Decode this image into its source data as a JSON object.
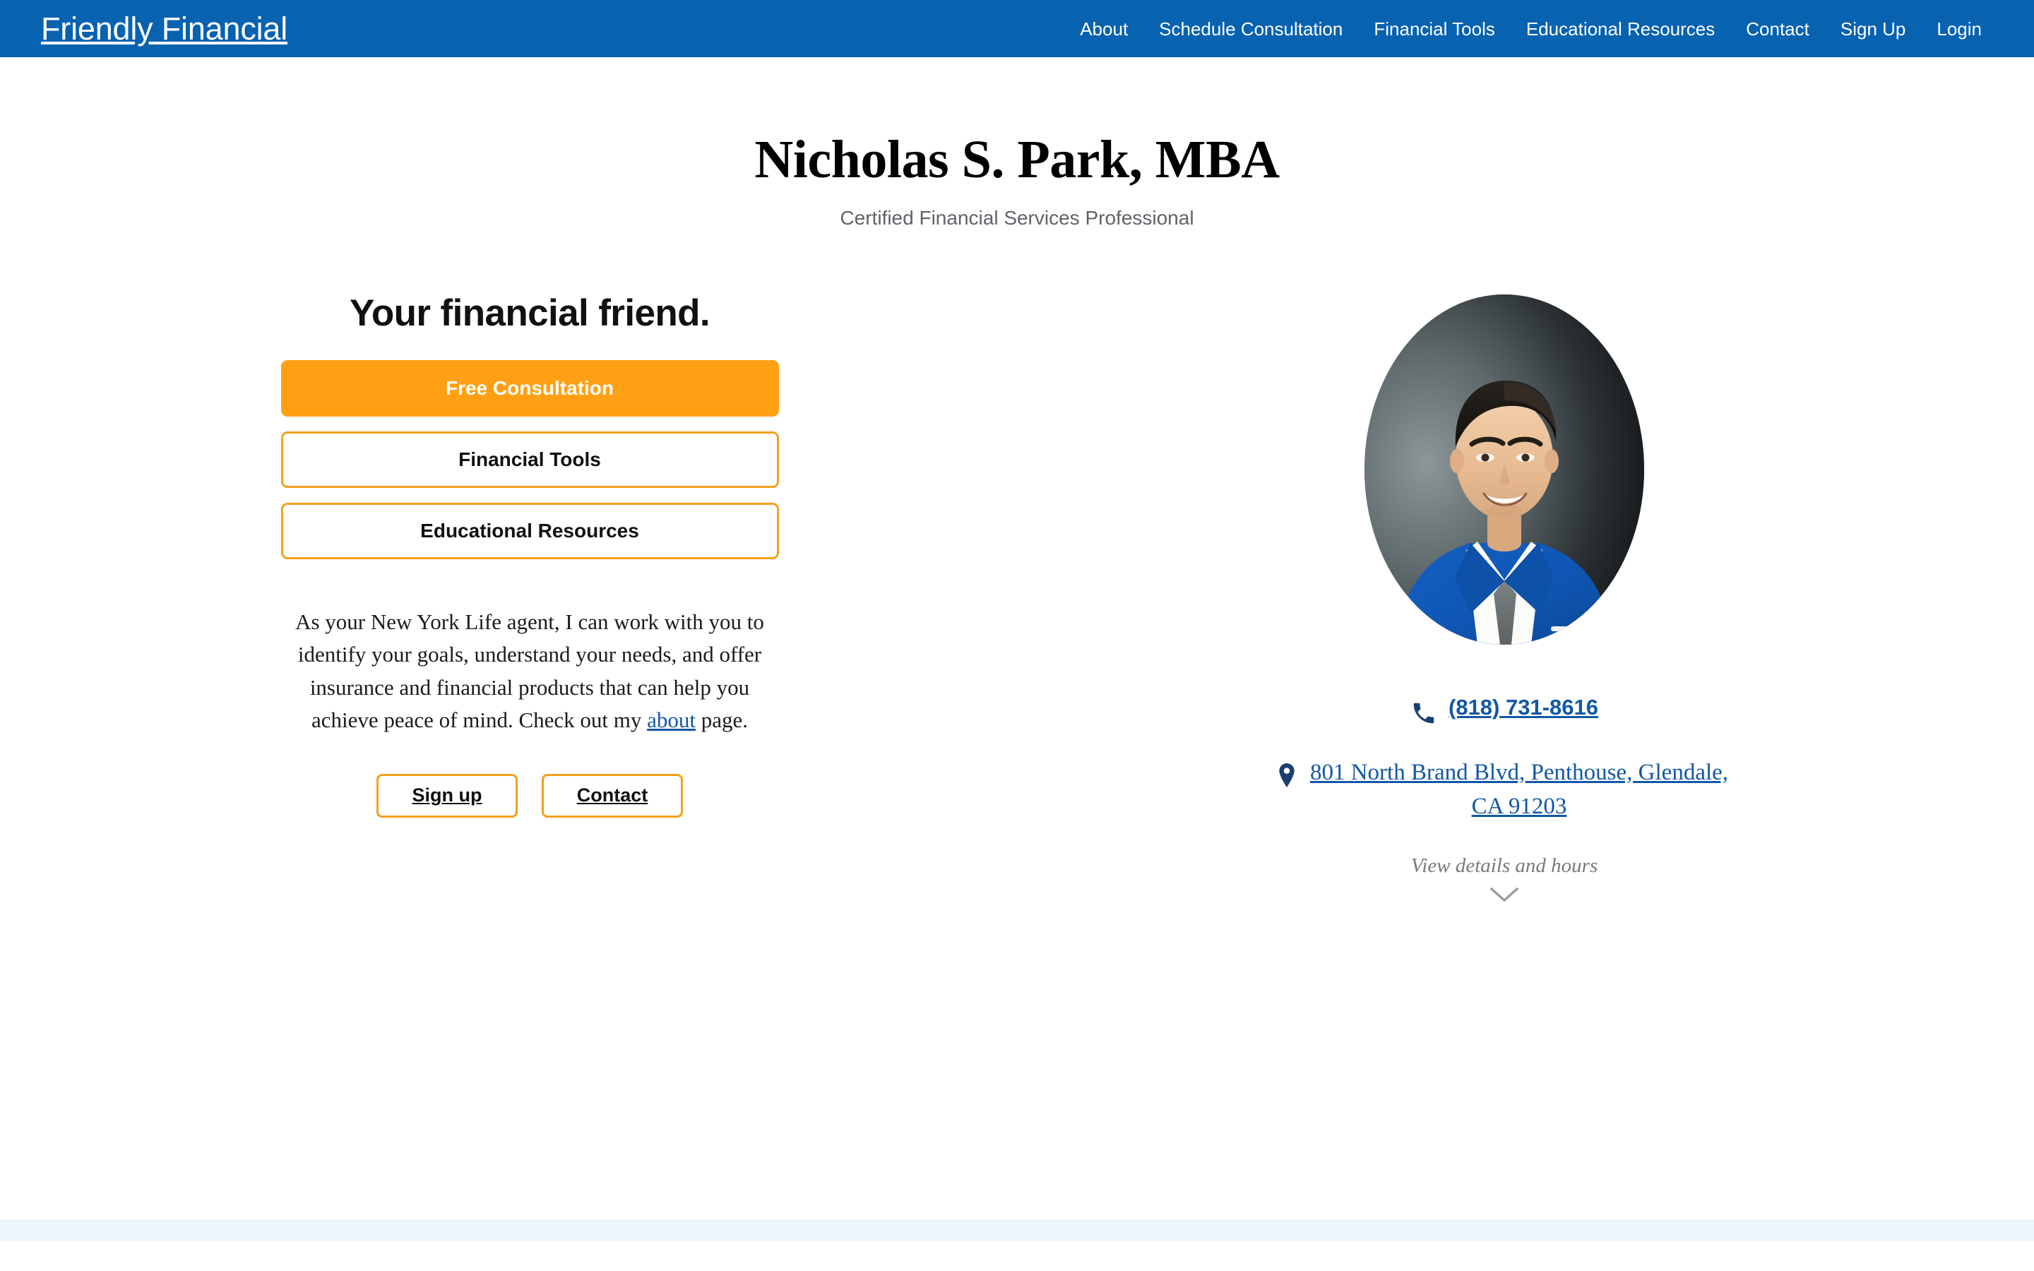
{
  "navbar": {
    "brand": "Friendly Financial",
    "links": [
      {
        "label": "About"
      },
      {
        "label": "Schedule Consultation"
      },
      {
        "label": "Financial Tools"
      },
      {
        "label": "Educational Resources"
      },
      {
        "label": "Contact"
      },
      {
        "label": "Sign Up"
      },
      {
        "label": "Login"
      }
    ],
    "background_color": "#0762b0",
    "text_color": "#ffffff"
  },
  "header": {
    "name": "Nicholas S. Park, MBA",
    "subtitle": "Certified Financial Services Professional"
  },
  "left_column": {
    "tagline": "Your financial friend.",
    "cta_buttons": [
      {
        "label": "Free Consultation",
        "style": "primary",
        "color": "#ffa014"
      },
      {
        "label": "Financial Tools",
        "style": "outline",
        "color": "#f2a01e"
      },
      {
        "label": "Educational Resources",
        "style": "outline",
        "color": "#f2a01e"
      }
    ],
    "blurb": {
      "before_link": "As your New York Life agent, I can work with you to identify your goals, understand your needs, and offer insurance and financial products that can help you achieve peace of mind. Check out my ",
      "link_text": "about",
      "after_link": " page."
    },
    "small_buttons": [
      {
        "label": "Sign up"
      },
      {
        "label": "Contact"
      }
    ]
  },
  "right_column": {
    "portrait_alt": "Headshot of Nicholas S. Park in a blue suit",
    "phone_icon": "phone-icon",
    "phone": "(818) 731-8616",
    "pin_icon": "map-pin-icon",
    "address_line_1": "801 North Brand Blvd, Penthouse,",
    "address_line_2": "Glendale, CA 91203",
    "address_full": "801 North Brand Blvd, Penthouse, Glendale, CA 91203",
    "view_details": "View details and hours",
    "chevron_icon": "chevron-down-icon"
  },
  "colors": {
    "brand_blue": "#0762b0",
    "link_blue": "#1257a5",
    "accent_orange": "#ffa014",
    "outline_orange": "#f2a01e",
    "band_blue": "#eff5fd",
    "muted_gray": "#5f6368"
  }
}
